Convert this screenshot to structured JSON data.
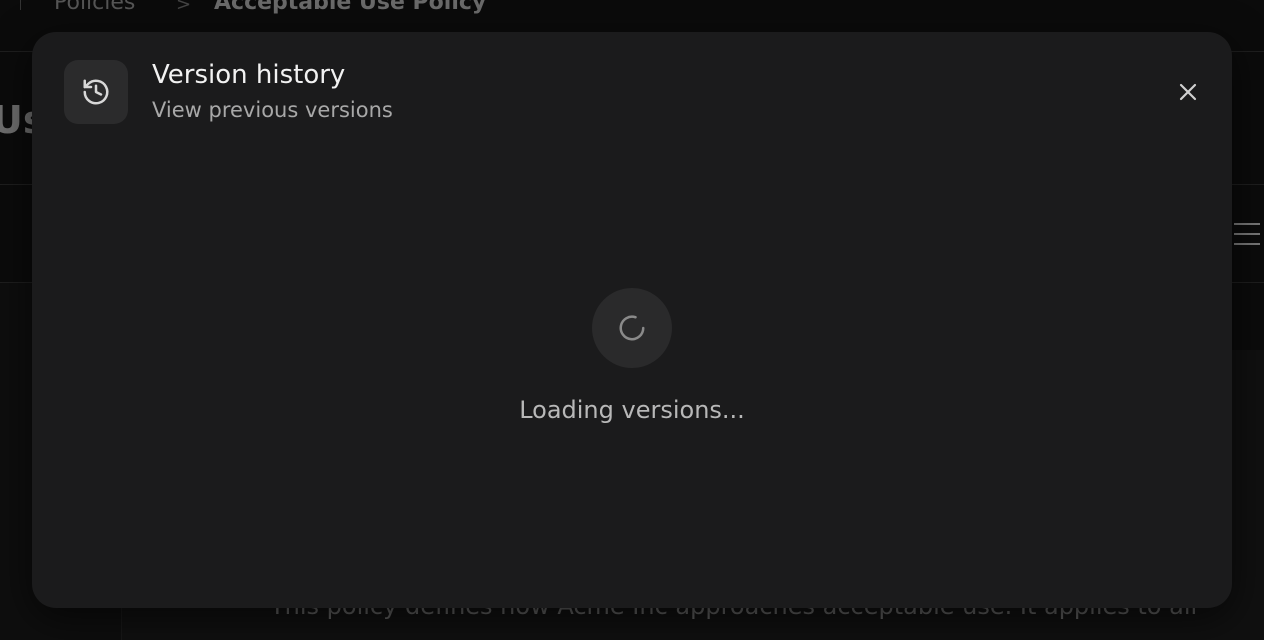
{
  "background": {
    "breadcrumb": {
      "parent": "Policies",
      "separator": ">",
      "current": "Acceptable Use Policy"
    },
    "page_title_fragment": "Us",
    "body_text": "This policy defines how Acme Inc approaches acceptable use. It applies to all"
  },
  "modal": {
    "icon": "history-icon",
    "title": "Version history",
    "subtitle": "View previous versions",
    "close_icon": "close-icon",
    "loading_icon": "spinner-icon",
    "loading_text": "Loading versions..."
  }
}
